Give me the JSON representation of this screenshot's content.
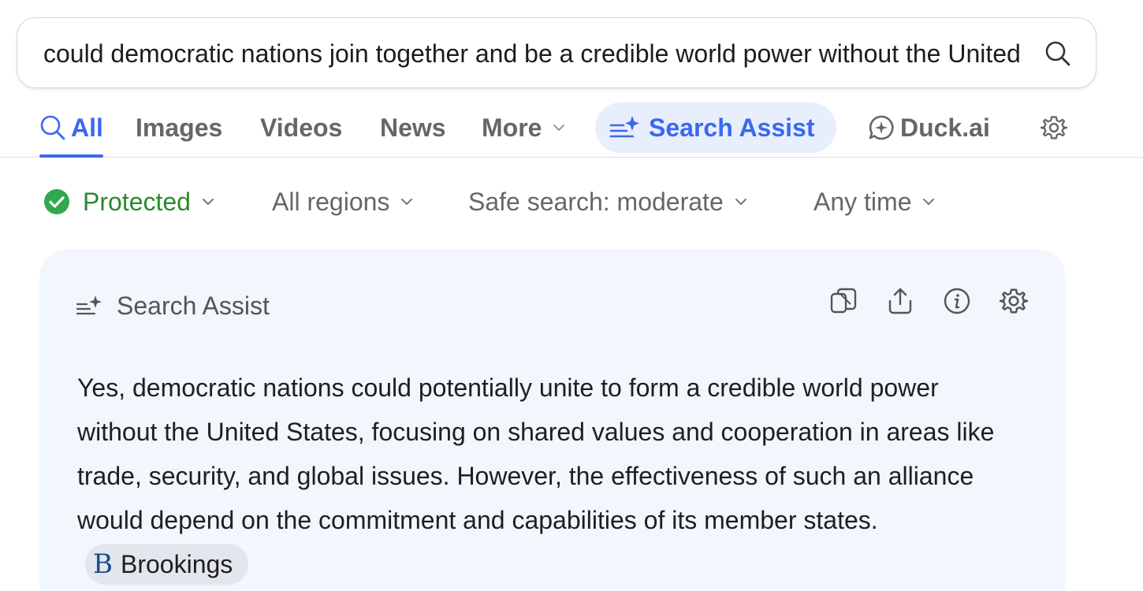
{
  "search": {
    "query": "could democratic nations join together and be a credible world power without the United States"
  },
  "tabs": {
    "all": "All",
    "images": "Images",
    "videos": "Videos",
    "news": "News",
    "more": "More",
    "search_assist": "Search Assist",
    "duck_ai": "Duck.ai"
  },
  "filters": {
    "protected": "Protected",
    "regions": "All regions",
    "safe_search": "Safe search: moderate",
    "time": "Any time"
  },
  "assist_card": {
    "title": "Search Assist",
    "answer": "Yes, democratic nations could potentially unite to form a credible world power without the United States, focusing on shared values and cooperation in areas like trade, security, and global issues. However, the effectiveness of such an alliance would depend on the commitment and capabilities of its member states.",
    "source": {
      "logo": "B",
      "name": "Brookings"
    }
  },
  "colors": {
    "accent": "#3969ef",
    "protected_green": "#2a8a2a",
    "card_background": "#f2f6fd"
  },
  "icons": [
    "search-icon",
    "sparkle-list-icon",
    "chat-sparkle-icon",
    "gear-icon",
    "check-circle-icon",
    "chevron-down-icon",
    "copy-icon",
    "share-icon",
    "info-icon"
  ]
}
